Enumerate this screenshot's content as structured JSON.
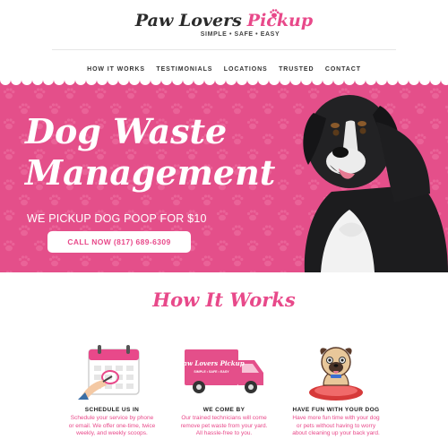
{
  "brand": {
    "name_part1": "Paw Lovers",
    "name_part2": "Pickup",
    "tagline": "SIMPLE • SAFE • EASY"
  },
  "nav": {
    "items": [
      "HOW IT WORKS",
      "TESTIMONIALS",
      "LOCATIONS",
      "TRUSTED",
      "CONTACT"
    ]
  },
  "hero": {
    "title_line1": "Dog Waste",
    "title_line2": "Management",
    "subtitle": "WE PICKUP DOG POOP FOR $10",
    "cta_label": "CALL NOW (817) 689-6309"
  },
  "how_it_works": {
    "title": "How It Works",
    "truck_logo_line1": "Paw Lovers Pickup",
    "truck_logo_line2": "SIMPLE • SAFE • EASY",
    "steps": [
      {
        "title": "SCHEDULE US IN",
        "text": "Schedule your service by phone or email. We offer one-time, twice weekly, and weekly scoops.",
        "icon": "calendar-icon"
      },
      {
        "title": "WE COME BY",
        "text": "Our trained technicians will come remove pet waste from your yard. All hassle-free to you.",
        "icon": "truck-icon"
      },
      {
        "title": "HAVE FUN WITH YOUR DOG",
        "text": "Have more fun time with your dog or pets without having to worry about cleaning up your back yard.",
        "icon": "pug-icon"
      }
    ]
  },
  "colors": {
    "accent": "#e8498a",
    "hero_bg": "#e44f8a",
    "text": "#333333"
  }
}
